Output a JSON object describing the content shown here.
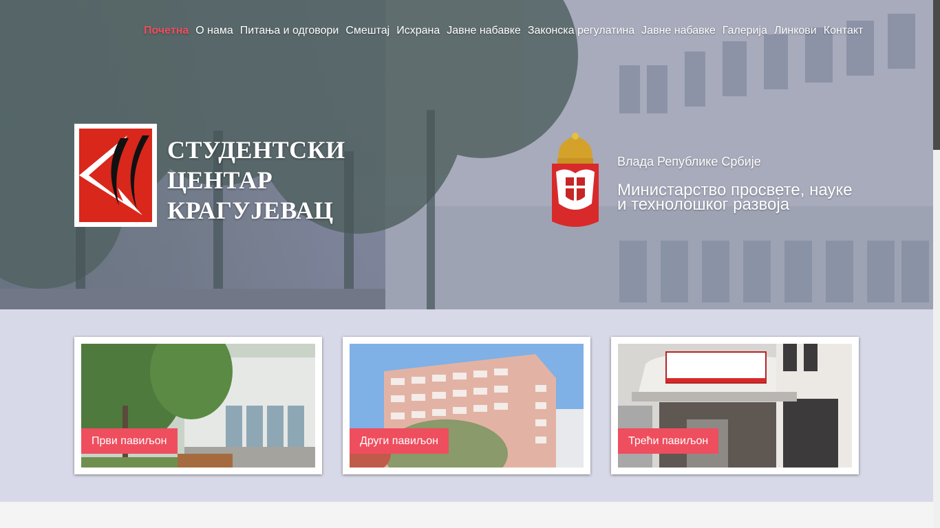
{
  "nav": {
    "items": [
      {
        "label": "Почетна",
        "active": true
      },
      {
        "label": "О нама"
      },
      {
        "label": "Питања и одговори"
      },
      {
        "label": "Смештај"
      },
      {
        "label": "Исхрана"
      },
      {
        "label": "Јавне набавке"
      },
      {
        "label": "Законска регулатина"
      },
      {
        "label": "Јавне набавке"
      },
      {
        "label": "Галерија"
      },
      {
        "label": "Линкови"
      },
      {
        "label": "Контакт"
      }
    ],
    "active_color": "#ee4e5e"
  },
  "brand": {
    "line1": "СТУДЕНТСКИ",
    "line2": "ЦЕНТАР",
    "line3": "КРАГУЈЕВАЦ",
    "logo_icon": "sckg-logo-icon",
    "logo_color": "#d9271c"
  },
  "government": {
    "coat_icon": "serbia-coat-of-arms-icon",
    "line": "Влада Републике Србије",
    "ministry_line1": "Министарство просвете, науке",
    "ministry_line2": "и технолошког развоја"
  },
  "cards": [
    {
      "label": "Први павиљон",
      "image": "pavilion-1-photo"
    },
    {
      "label": "Други павиљон",
      "image": "pavilion-2-photo"
    },
    {
      "label": "Трећи павиљон",
      "image": "pavilion-3-photo"
    }
  ],
  "colors": {
    "accent": "#ee4e5e",
    "band": "#d8d9e8"
  }
}
